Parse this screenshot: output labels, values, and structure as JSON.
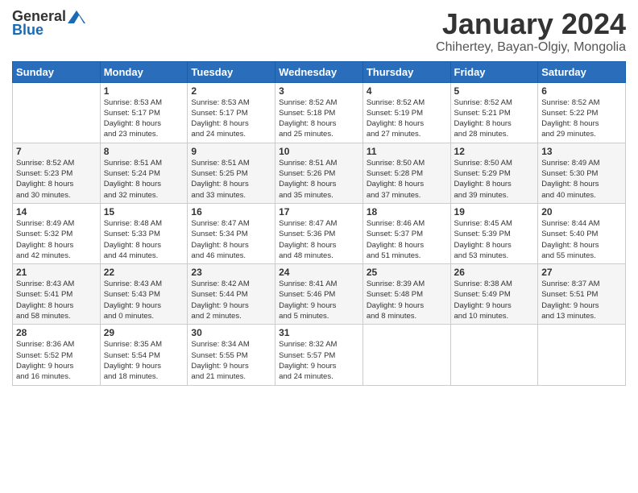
{
  "logo": {
    "general": "General",
    "blue": "Blue"
  },
  "header": {
    "title": "January 2024",
    "location": "Chihertey, Bayan-Olgiy, Mongolia"
  },
  "days_of_week": [
    "Sunday",
    "Monday",
    "Tuesday",
    "Wednesday",
    "Thursday",
    "Friday",
    "Saturday"
  ],
  "weeks": [
    [
      {
        "day": "",
        "info": ""
      },
      {
        "day": "1",
        "info": "Sunrise: 8:53 AM\nSunset: 5:17 PM\nDaylight: 8 hours\nand 23 minutes."
      },
      {
        "day": "2",
        "info": "Sunrise: 8:53 AM\nSunset: 5:17 PM\nDaylight: 8 hours\nand 24 minutes."
      },
      {
        "day": "3",
        "info": "Sunrise: 8:52 AM\nSunset: 5:18 PM\nDaylight: 8 hours\nand 25 minutes."
      },
      {
        "day": "4",
        "info": "Sunrise: 8:52 AM\nSunset: 5:19 PM\nDaylight: 8 hours\nand 27 minutes."
      },
      {
        "day": "5",
        "info": "Sunrise: 8:52 AM\nSunset: 5:21 PM\nDaylight: 8 hours\nand 28 minutes."
      },
      {
        "day": "6",
        "info": "Sunrise: 8:52 AM\nSunset: 5:22 PM\nDaylight: 8 hours\nand 29 minutes."
      }
    ],
    [
      {
        "day": "7",
        "info": "Sunrise: 8:52 AM\nSunset: 5:23 PM\nDaylight: 8 hours\nand 30 minutes."
      },
      {
        "day": "8",
        "info": "Sunrise: 8:51 AM\nSunset: 5:24 PM\nDaylight: 8 hours\nand 32 minutes."
      },
      {
        "day": "9",
        "info": "Sunrise: 8:51 AM\nSunset: 5:25 PM\nDaylight: 8 hours\nand 33 minutes."
      },
      {
        "day": "10",
        "info": "Sunrise: 8:51 AM\nSunset: 5:26 PM\nDaylight: 8 hours\nand 35 minutes."
      },
      {
        "day": "11",
        "info": "Sunrise: 8:50 AM\nSunset: 5:28 PM\nDaylight: 8 hours\nand 37 minutes."
      },
      {
        "day": "12",
        "info": "Sunrise: 8:50 AM\nSunset: 5:29 PM\nDaylight: 8 hours\nand 39 minutes."
      },
      {
        "day": "13",
        "info": "Sunrise: 8:49 AM\nSunset: 5:30 PM\nDaylight: 8 hours\nand 40 minutes."
      }
    ],
    [
      {
        "day": "14",
        "info": "Sunrise: 8:49 AM\nSunset: 5:32 PM\nDaylight: 8 hours\nand 42 minutes."
      },
      {
        "day": "15",
        "info": "Sunrise: 8:48 AM\nSunset: 5:33 PM\nDaylight: 8 hours\nand 44 minutes."
      },
      {
        "day": "16",
        "info": "Sunrise: 8:47 AM\nSunset: 5:34 PM\nDaylight: 8 hours\nand 46 minutes."
      },
      {
        "day": "17",
        "info": "Sunrise: 8:47 AM\nSunset: 5:36 PM\nDaylight: 8 hours\nand 48 minutes."
      },
      {
        "day": "18",
        "info": "Sunrise: 8:46 AM\nSunset: 5:37 PM\nDaylight: 8 hours\nand 51 minutes."
      },
      {
        "day": "19",
        "info": "Sunrise: 8:45 AM\nSunset: 5:39 PM\nDaylight: 8 hours\nand 53 minutes."
      },
      {
        "day": "20",
        "info": "Sunrise: 8:44 AM\nSunset: 5:40 PM\nDaylight: 8 hours\nand 55 minutes."
      }
    ],
    [
      {
        "day": "21",
        "info": "Sunrise: 8:43 AM\nSunset: 5:41 PM\nDaylight: 8 hours\nand 58 minutes."
      },
      {
        "day": "22",
        "info": "Sunrise: 8:43 AM\nSunset: 5:43 PM\nDaylight: 9 hours\nand 0 minutes."
      },
      {
        "day": "23",
        "info": "Sunrise: 8:42 AM\nSunset: 5:44 PM\nDaylight: 9 hours\nand 2 minutes."
      },
      {
        "day": "24",
        "info": "Sunrise: 8:41 AM\nSunset: 5:46 PM\nDaylight: 9 hours\nand 5 minutes."
      },
      {
        "day": "25",
        "info": "Sunrise: 8:39 AM\nSunset: 5:48 PM\nDaylight: 9 hours\nand 8 minutes."
      },
      {
        "day": "26",
        "info": "Sunrise: 8:38 AM\nSunset: 5:49 PM\nDaylight: 9 hours\nand 10 minutes."
      },
      {
        "day": "27",
        "info": "Sunrise: 8:37 AM\nSunset: 5:51 PM\nDaylight: 9 hours\nand 13 minutes."
      }
    ],
    [
      {
        "day": "28",
        "info": "Sunrise: 8:36 AM\nSunset: 5:52 PM\nDaylight: 9 hours\nand 16 minutes."
      },
      {
        "day": "29",
        "info": "Sunrise: 8:35 AM\nSunset: 5:54 PM\nDaylight: 9 hours\nand 18 minutes."
      },
      {
        "day": "30",
        "info": "Sunrise: 8:34 AM\nSunset: 5:55 PM\nDaylight: 9 hours\nand 21 minutes."
      },
      {
        "day": "31",
        "info": "Sunrise: 8:32 AM\nSunset: 5:57 PM\nDaylight: 9 hours\nand 24 minutes."
      },
      {
        "day": "",
        "info": ""
      },
      {
        "day": "",
        "info": ""
      },
      {
        "day": "",
        "info": ""
      }
    ]
  ]
}
